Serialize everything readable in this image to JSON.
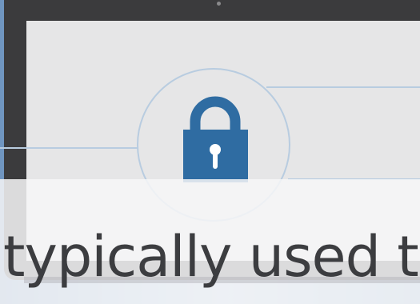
{
  "caption": {
    "text": "typically used to"
  },
  "icons": {
    "lock": "lock-icon",
    "circle": "security-ring"
  },
  "colors": {
    "lock": "#2f6ca2",
    "ring": "#b8cce0",
    "frame": "#3b3b3d",
    "screen": "#e6e6e7",
    "caption": "#3c3d40"
  }
}
